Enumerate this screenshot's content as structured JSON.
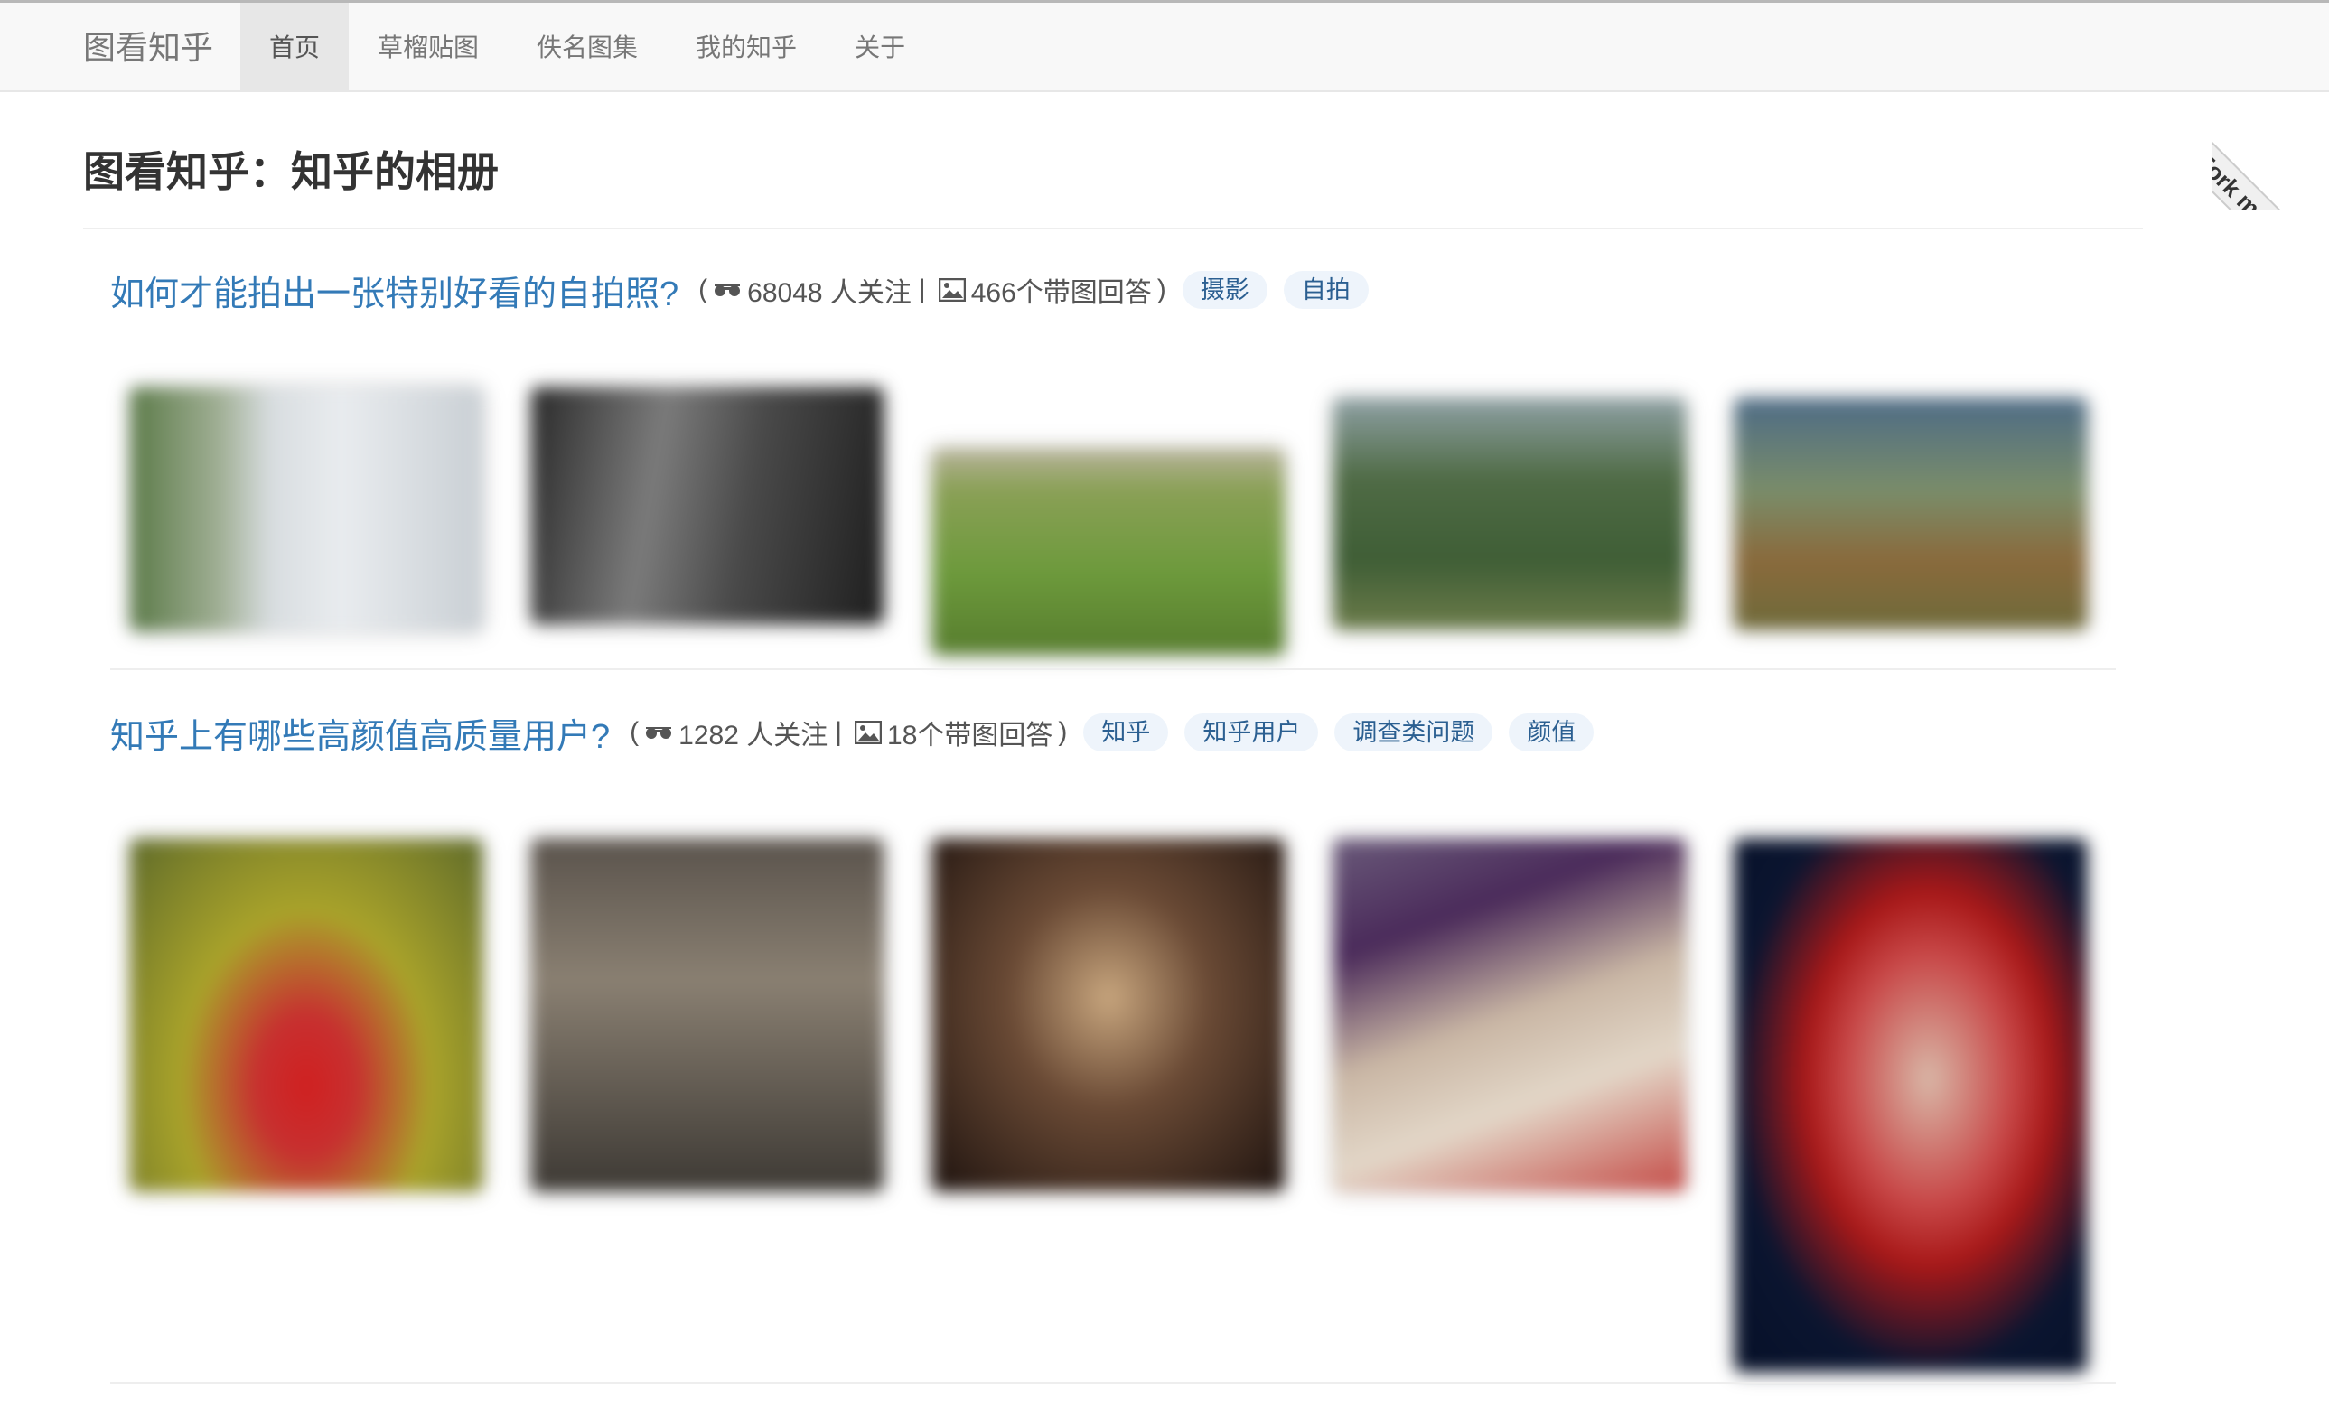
{
  "nav": {
    "brand": "图看知乎",
    "items": [
      {
        "label": "首页",
        "active": true
      },
      {
        "label": "草榴贴图",
        "active": false
      },
      {
        "label": "佚名图集",
        "active": false
      },
      {
        "label": "我的知乎",
        "active": false
      },
      {
        "label": "关于",
        "active": false
      }
    ]
  },
  "ribbon": {
    "text": "Fork me on GitHub"
  },
  "page": {
    "title": "图看知乎：知乎的相册"
  },
  "questions": [
    {
      "title": "如何才能拍出一张特别好看的自拍照?",
      "open_paren": "(",
      "followers": "68048 人关注",
      "separator": "|",
      "answers": "466个带图回答",
      "close_paren": ")",
      "tags": [
        "摄影",
        "自拍"
      ]
    },
    {
      "title": "知乎上有哪些高颜值高质量用户?",
      "open_paren": "(",
      "followers": "1282 人关注",
      "separator": "|",
      "answers": "18个带图回答",
      "close_paren": ")",
      "tags": [
        "知乎",
        "知乎用户",
        "调查类问题",
        "颜值"
      ]
    }
  ],
  "icons": {
    "followers": "glasses-icon",
    "answers": "picture-icon"
  },
  "colors": {
    "link": "#337ab7",
    "tag_bg": "#eef4fb",
    "tag_text": "#2b5f91",
    "navbar_bg": "#f8f8f8"
  }
}
